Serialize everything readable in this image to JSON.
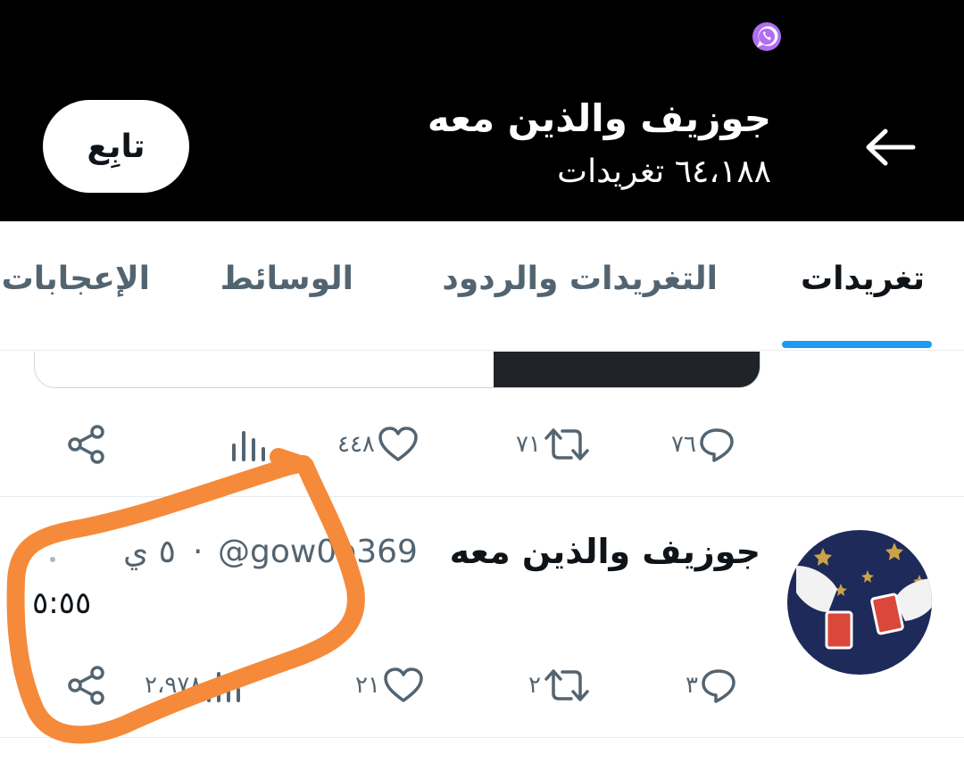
{
  "header": {
    "profile_name": "جوزيف والذين معه",
    "tweet_count": "٦٤،١٨٨ تغريدات",
    "follow_label": "تابِع"
  },
  "tabs": [
    {
      "label": "تغريدات",
      "active": true
    },
    {
      "label": "التغريدات والردود",
      "active": false
    },
    {
      "label": "الوسائط",
      "active": false
    },
    {
      "label": "الإعجابات",
      "active": false
    }
  ],
  "previous_tweet": {
    "replies": "٧٦",
    "retweets": "٧١",
    "likes": "٤٤٨",
    "views": ""
  },
  "tweet": {
    "author": "جوزيف والذين معه",
    "handle": "@gow0o369",
    "separator": "·",
    "time": "٥ ي",
    "text": "٥:٥٥",
    "replies": "٣",
    "retweets": "٢",
    "likes": "٢١",
    "views": "٢،٩٧٨"
  },
  "colors": {
    "accent": "#1d9bf0",
    "annotation": "#f58a3a",
    "header_bg": "#000000"
  },
  "icons": [
    "back-arrow-icon",
    "whatsapp-icon",
    "reply-icon",
    "retweet-icon",
    "like-icon",
    "views-icon",
    "share-icon"
  ]
}
